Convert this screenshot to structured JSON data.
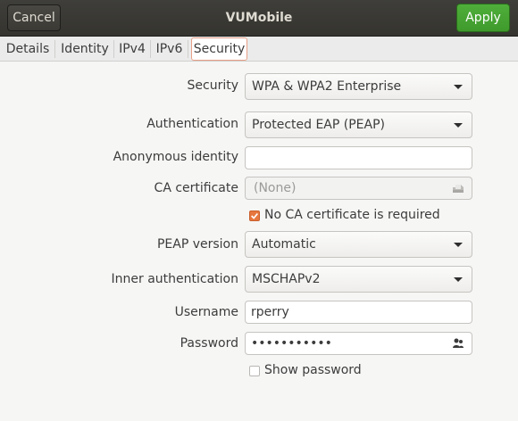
{
  "window": {
    "title": "VUMobile",
    "cancel_label": "Cancel",
    "apply_label": "Apply"
  },
  "tabs": [
    {
      "label": "Details"
    },
    {
      "label": "Identity"
    },
    {
      "label": "IPv4"
    },
    {
      "label": "IPv6"
    },
    {
      "label": "Security",
      "active": true
    }
  ],
  "form": {
    "security": {
      "label": "Security",
      "value": "WPA & WPA2 Enterprise"
    },
    "authentication": {
      "label": "Authentication",
      "value": "Protected EAP (PEAP)"
    },
    "anonymous_identity": {
      "label": "Anonymous identity",
      "value": ""
    },
    "ca_certificate": {
      "label": "CA certificate",
      "value": "(None)"
    },
    "no_ca_required": {
      "label": "No CA certificate is required",
      "checked": true
    },
    "peap_version": {
      "label": "PEAP version",
      "value": "Automatic"
    },
    "inner_authentication": {
      "label": "Inner authentication",
      "value": "MSCHAPv2"
    },
    "username": {
      "label": "Username",
      "value": "rperry"
    },
    "password": {
      "label": "Password",
      "value": "•••••••••••"
    },
    "show_password": {
      "label": "Show password",
      "checked": false
    }
  },
  "icons": {
    "file_picker": "file-chooser-icon",
    "password_users": "users-icon"
  },
  "colors": {
    "header_bg": "#3b3a35",
    "apply_green": "#45a332",
    "check_orange": "#e7773f",
    "tab_active_border": "#e8a088"
  }
}
